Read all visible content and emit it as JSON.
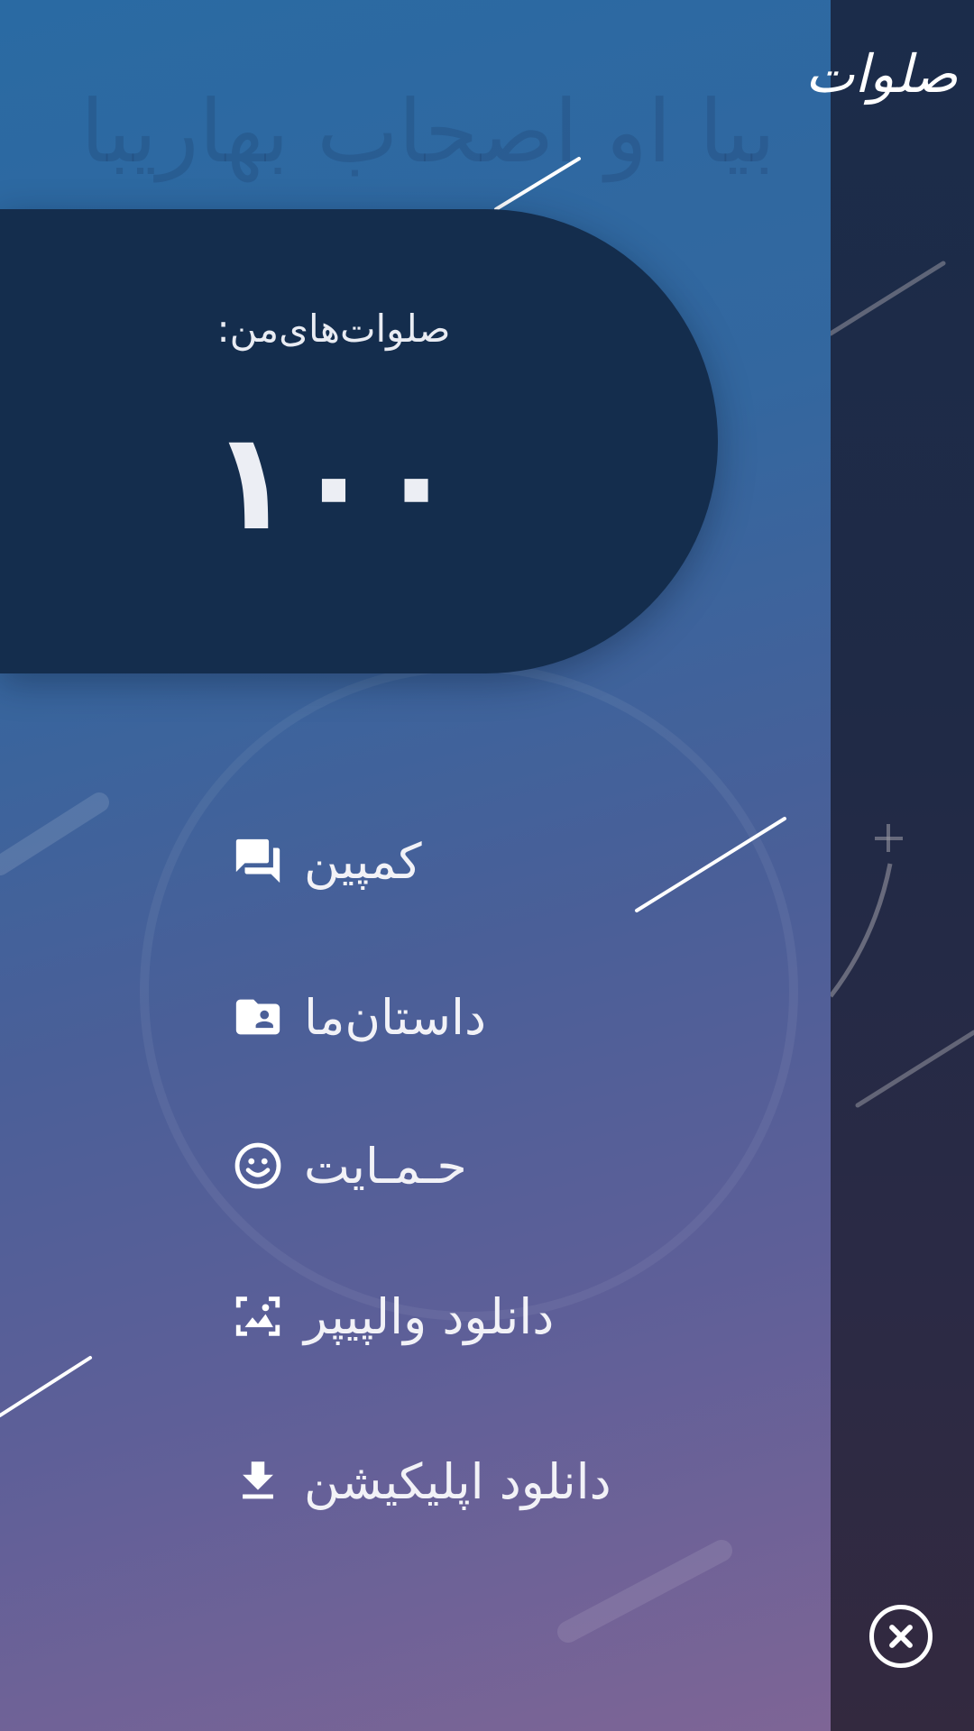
{
  "app": {
    "logo_text": "صلوات"
  },
  "background": {
    "faint_text": "بیا او اصحاب بهاریبا"
  },
  "counter": {
    "label": "صلوات‌های‌من:",
    "value": "۱۰۰"
  },
  "menu": {
    "items": [
      {
        "label": "کمپین",
        "icon": "forum-icon"
      },
      {
        "label": "داستان‌ما",
        "icon": "folder-user-icon"
      },
      {
        "label": "حـمـایت",
        "icon": "smiley-icon"
      },
      {
        "label": "دانلود والپیپر",
        "icon": "wallpaper-icon"
      },
      {
        "label": "دانلود اپلیکیشن",
        "icon": "download-icon"
      }
    ]
  },
  "close": {
    "icon": "close-icon"
  },
  "colors": {
    "card": "#142d4d",
    "side_strip": "#1f2a46",
    "gradient_top": "#2a6aa3",
    "gradient_bottom": "#7e6596",
    "text": "#f2f2f7"
  }
}
